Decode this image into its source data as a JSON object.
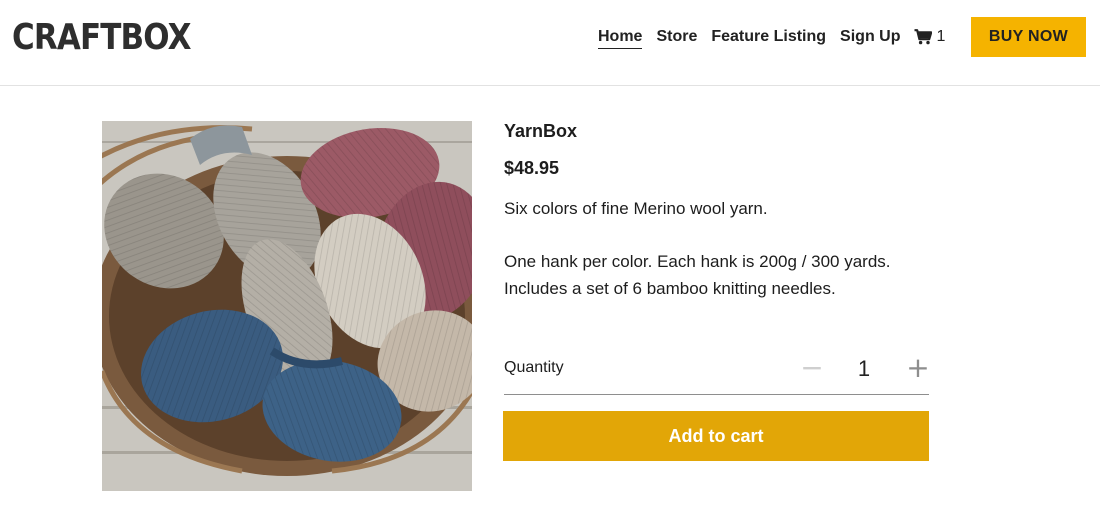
{
  "header": {
    "logo": "CRAFTBOX",
    "nav": [
      {
        "label": "Home",
        "active": true
      },
      {
        "label": "Store",
        "active": false
      },
      {
        "label": "Feature Listing",
        "active": false
      },
      {
        "label": "Sign Up",
        "active": false
      }
    ],
    "cart_icon": "shopping-cart-icon",
    "cart_count": "1",
    "buy_now_label": "BUY NOW"
  },
  "product": {
    "image_icon": "yarn-basket-photo",
    "title": "YarnBox",
    "price": "$48.95",
    "description_1": "Six colors of fine Merino wool yarn.",
    "description_2": "One hank per color. Each hank is 200g / 300 yards. Includes a set of 6 bamboo knitting needles.",
    "quantity_label": "Quantity",
    "quantity_value": "1",
    "minus_symbol": "−",
    "plus_symbol": "+",
    "add_to_cart_label": "Add to cart"
  },
  "colors": {
    "accent": "#f5b300",
    "add_to_cart": "#e2a607"
  }
}
